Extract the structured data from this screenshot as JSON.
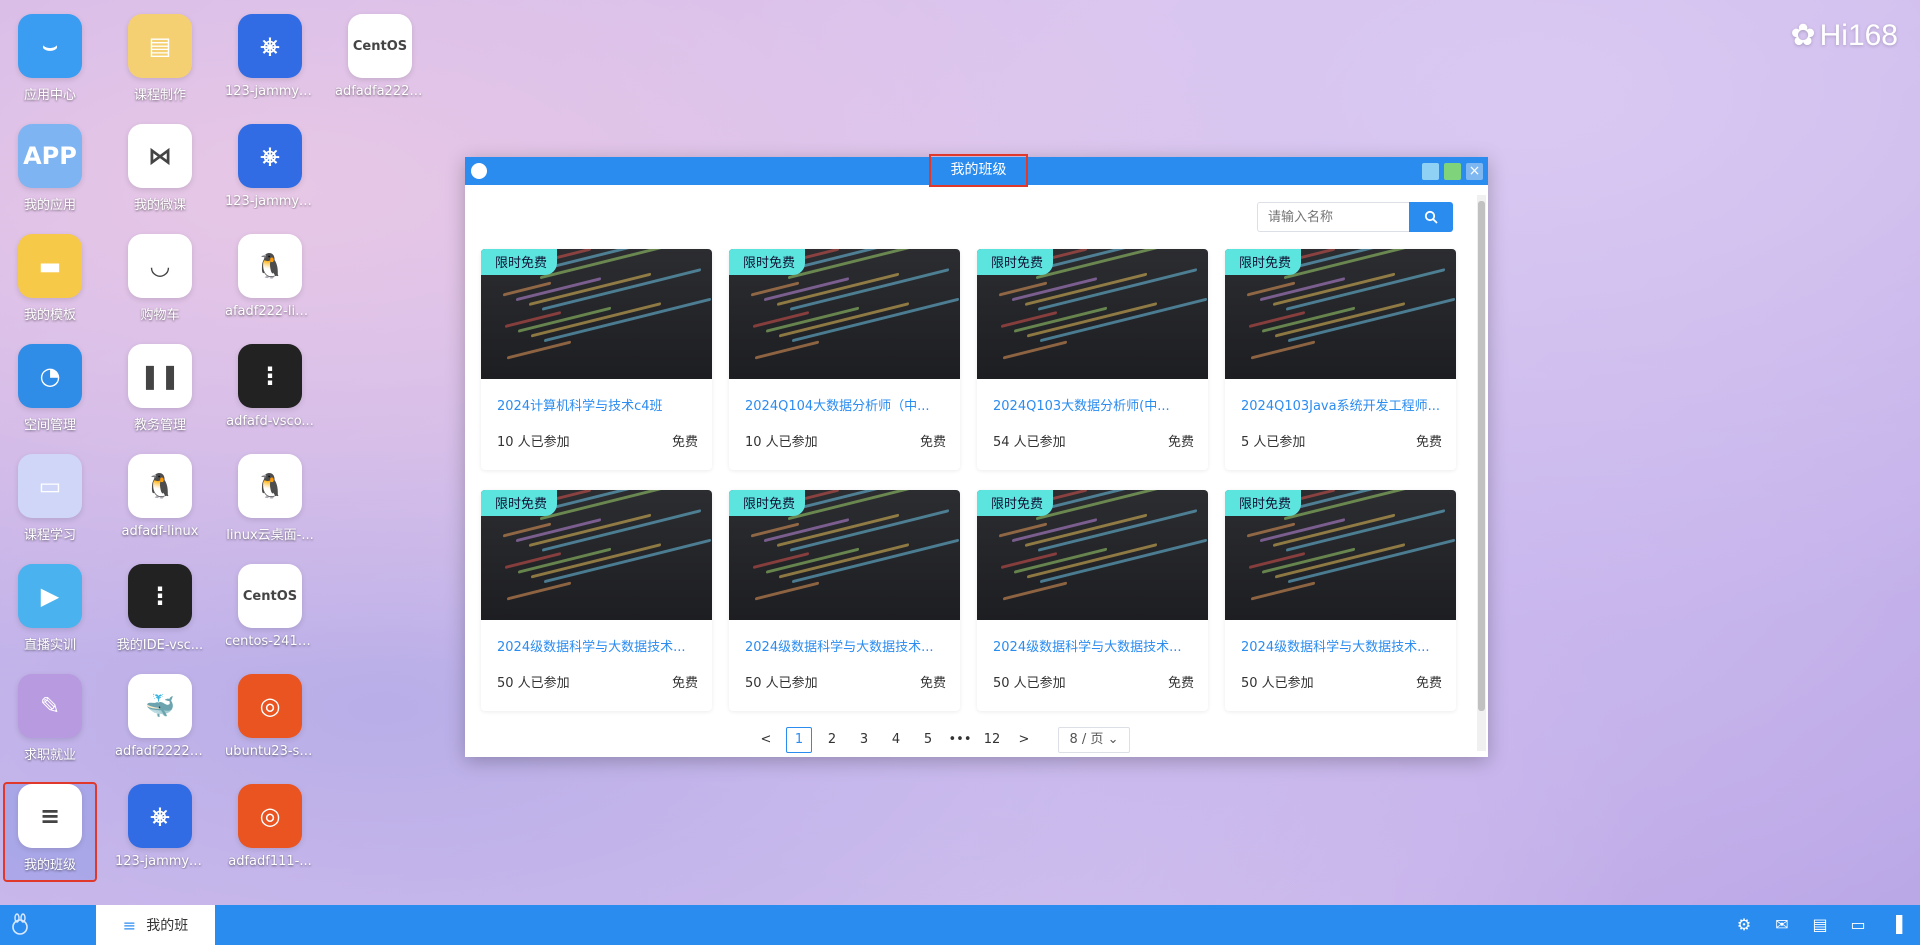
{
  "desktop": {
    "icons": [
      {
        "label": "应用中心",
        "color": "#3a9df2",
        "glyph": "⌣"
      },
      {
        "label": "我的应用",
        "color": "#7eb4f2",
        "glyph": "APP"
      },
      {
        "label": "我的模板",
        "color": "#f7c948",
        "glyph": "▬"
      },
      {
        "label": "空间管理",
        "color": "#2f8de8",
        "glyph": "◔"
      },
      {
        "label": "课程学习",
        "color": "#cfd6f8",
        "glyph": "▭"
      },
      {
        "label": "直播实训",
        "color": "#4ab2ee",
        "glyph": "▶"
      },
      {
        "label": "求职就业",
        "color": "#b89ae0",
        "glyph": "✎"
      },
      {
        "label": "我的班级",
        "color": "#ffffff",
        "glyph": "≡"
      },
      {
        "label": "课程制作",
        "color": "#f5d073",
        "glyph": "▤"
      },
      {
        "label": "我的微课",
        "color": "#ffffff",
        "glyph": "⋈"
      },
      {
        "label": "购物车",
        "color": "#ffffff",
        "glyph": "◡"
      },
      {
        "label": "教务管理",
        "color": "#ffffff",
        "glyph": "❚❚"
      },
      {
        "label": "adfadf-linux",
        "color": "#ffffff",
        "glyph": "🐧"
      },
      {
        "label": "我的IDE-vsc...",
        "color": "#222222",
        "glyph": "⋮"
      },
      {
        "label": "adfadf2222-j...",
        "color": "#ffffff",
        "glyph": "🐳"
      },
      {
        "label": "123-jammy-...",
        "color": "#326ce5",
        "glyph": "⎈"
      },
      {
        "label": "123-jammy-...",
        "color": "#326ce5",
        "glyph": "⎈"
      },
      {
        "label": "123-jammy-...",
        "color": "#326ce5",
        "glyph": "⎈"
      },
      {
        "label": "afadf222-linux",
        "color": "#ffffff",
        "glyph": "🐧"
      },
      {
        "label": "adfafd-vsco...",
        "color": "#222222",
        "glyph": "⋮"
      },
      {
        "label": "linux云桌面-...",
        "color": "#ffffff",
        "glyph": "🐧"
      },
      {
        "label": "centos-2410...",
        "color": "#ffffff",
        "glyph": "CentOS"
      },
      {
        "label": "ubuntu23-se...",
        "color": "#e95420",
        "glyph": "◎"
      },
      {
        "label": "adfadf111-...",
        "color": "#e95420",
        "glyph": "◎"
      },
      {
        "label": "adfadfa2221...",
        "color": "#ffffff",
        "glyph": "CentOS"
      }
    ],
    "brand": "Hi168"
  },
  "window": {
    "title": "我的班级",
    "search_placeholder": "请输入名称",
    "cards": [
      {
        "badge": "限时免费",
        "title": "2024计算机科学与技术c4班",
        "count": "10 人已参加",
        "price": "免费"
      },
      {
        "badge": "限时免费",
        "title": "2024Q104大数据分析师（中...",
        "count": "10 人已参加",
        "price": "免费"
      },
      {
        "badge": "限时免费",
        "title": "2024Q103大数据分析师(中...",
        "count": "54 人已参加",
        "price": "免费"
      },
      {
        "badge": "限时免费",
        "title": "2024Q103Java系统开发工程师...",
        "count": "5 人已参加",
        "price": "免费"
      },
      {
        "badge": "限时免费",
        "title": "2024级数据科学与大数据技术...",
        "count": "50 人已参加",
        "price": "免费"
      },
      {
        "badge": "限时免费",
        "title": "2024级数据科学与大数据技术...",
        "count": "50 人已参加",
        "price": "免费"
      },
      {
        "badge": "限时免费",
        "title": "2024级数据科学与大数据技术...",
        "count": "50 人已参加",
        "price": "免费"
      },
      {
        "badge": "限时免费",
        "title": "2024级数据科学与大数据技术...",
        "count": "50 人已参加",
        "price": "免费"
      }
    ],
    "pagination": {
      "prev": "<",
      "pages": [
        "1",
        "2",
        "3",
        "4",
        "5"
      ],
      "ellipsis": "•••",
      "last": "12",
      "next": ">",
      "size": "8 / 页 ⌄"
    }
  },
  "taskbar": {
    "task_label": "我的班"
  }
}
